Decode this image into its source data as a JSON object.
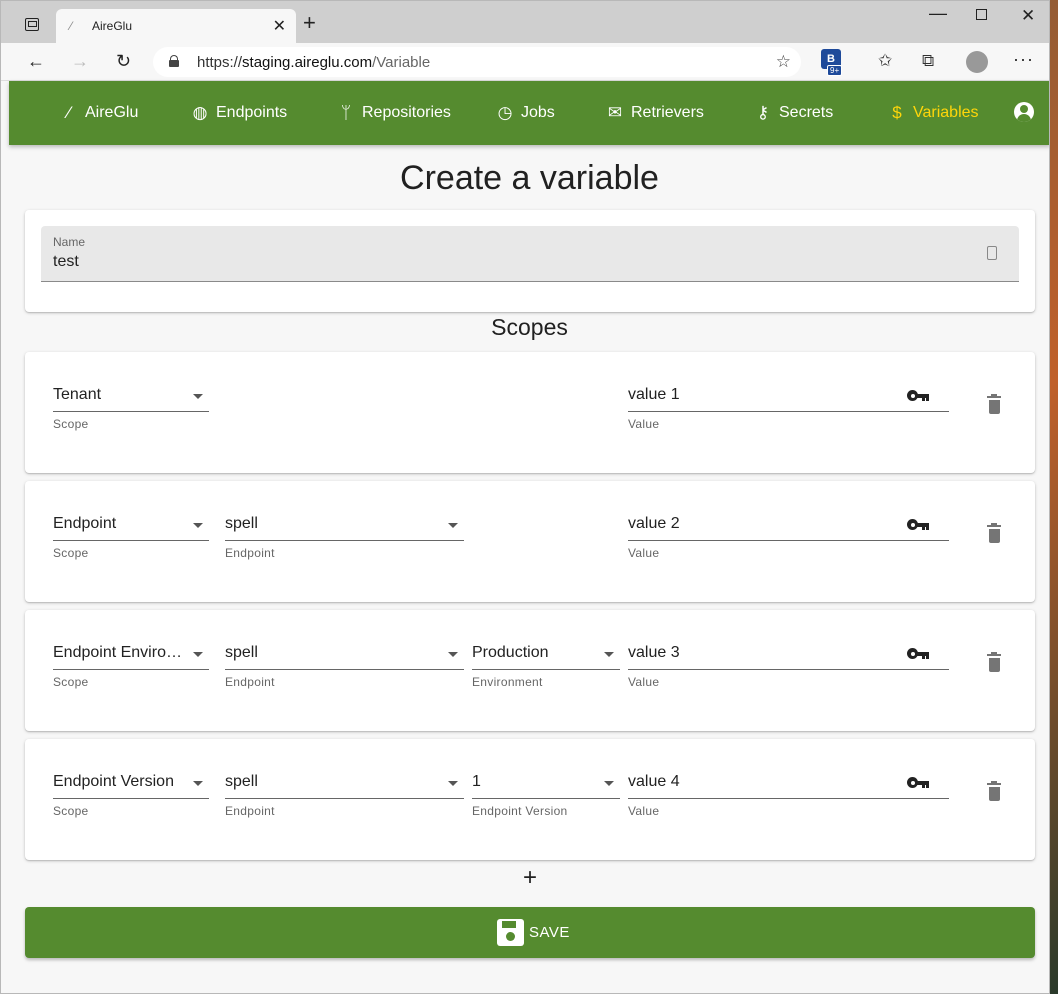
{
  "browser": {
    "tab_title": "AireGlu",
    "url_prefix": "https://",
    "url_host": "staging.aireglu.com",
    "url_path": "/Variable",
    "ext_badge": "9+"
  },
  "nav": {
    "brand": "AireGlu",
    "items": [
      {
        "label": "Endpoints",
        "icon": "globe-icon"
      },
      {
        "label": "Repositories",
        "icon": "branch-icon"
      },
      {
        "label": "Jobs",
        "icon": "clock-icon"
      },
      {
        "label": "Retrievers",
        "icon": "envelope-icon"
      },
      {
        "label": "Secrets",
        "icon": "key-icon"
      },
      {
        "label": "Variables",
        "icon": "dollar-icon",
        "active": true
      }
    ],
    "active_color": "#ffd60a",
    "bar_color": "#558b2f"
  },
  "page": {
    "title": "Create a variable",
    "name_label": "Name",
    "name_value": "test",
    "scopes_title": "Scopes",
    "save_label": "SAVE"
  },
  "scopes": [
    {
      "scope": "Tenant",
      "scope_helper": "Scope",
      "value": "value 1",
      "value_helper": "Value"
    },
    {
      "scope": "Endpoint",
      "scope_helper": "Scope",
      "endpoint": "spell",
      "endpoint_helper": "Endpoint",
      "value": "value 2",
      "value_helper": "Value"
    },
    {
      "scope": "Endpoint Environment",
      "scope_helper": "Scope",
      "endpoint": "spell",
      "endpoint_helper": "Endpoint",
      "extra": "Production",
      "extra_helper": "Environment",
      "value": "value 3",
      "value_helper": "Value"
    },
    {
      "scope": "Endpoint Version",
      "scope_helper": "Scope",
      "endpoint": "spell",
      "endpoint_helper": "Endpoint",
      "extra": "1",
      "extra_helper": "Endpoint Version",
      "value": "value 4",
      "value_helper": "Value"
    }
  ]
}
